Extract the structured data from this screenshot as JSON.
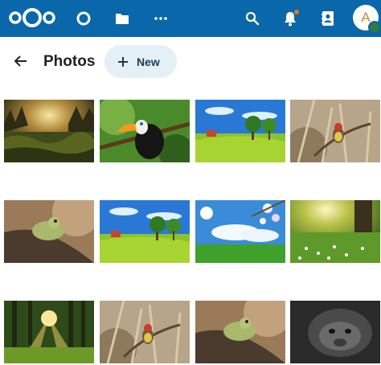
{
  "header": {
    "avatar_initial": "A",
    "background": "#0a67a9",
    "icons": [
      "nextcloud-logo",
      "circle-app-icon",
      "folder-icon",
      "more-apps-icon",
      "search-icon",
      "bell-icon",
      "contacts-icon",
      "avatar"
    ],
    "status": "online",
    "has_notification": true
  },
  "toolbar": {
    "title": "Photos",
    "new_label": "New",
    "icons": [
      "back-arrow-icon",
      "plus-icon"
    ]
  },
  "photos": [
    "forest-sunset",
    "toucan",
    "cartoon-meadow",
    "bird-in-reeds",
    "frog-on-rock",
    "cartoon-meadow",
    "sky-blossoms",
    "sunlit-flower-meadow",
    "forest-sunbeams",
    "bird-in-reeds",
    "frog-on-rock",
    "gorilla-bw"
  ]
}
